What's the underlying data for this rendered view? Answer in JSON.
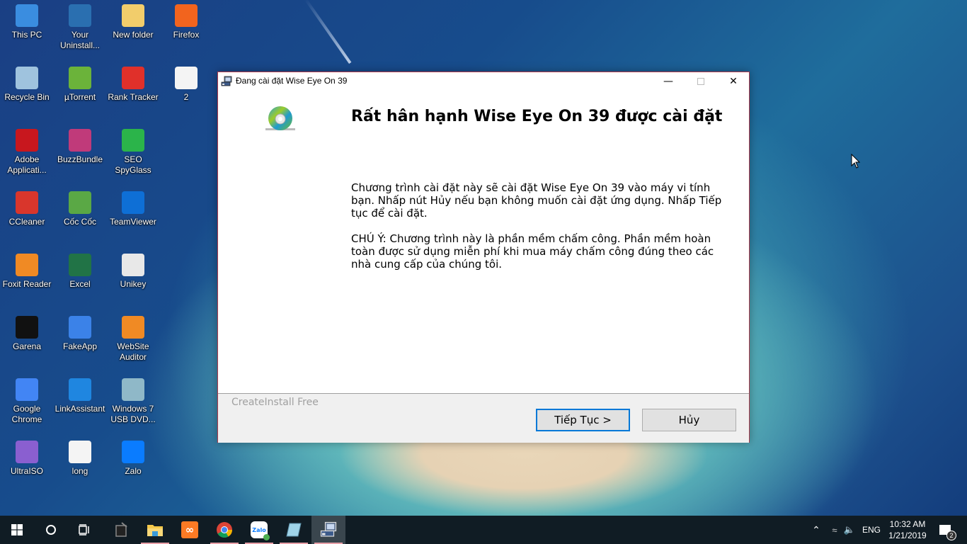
{
  "desktop": {
    "icons": [
      {
        "label": "This PC",
        "icon": "computer-icon",
        "color": "#3a8de0"
      },
      {
        "label": "Your Uninstall...",
        "icon": "uninstaller-icon",
        "color": "#2a6fb0"
      },
      {
        "label": "New folder",
        "icon": "folder-icon",
        "color": "#f2cd6b"
      },
      {
        "label": "Firefox",
        "icon": "firefox-icon",
        "color": "#f2641e"
      },
      {
        "label": "Recycle Bin",
        "icon": "recycle-bin-icon",
        "color": "#9fc3de"
      },
      {
        "label": "µTorrent",
        "icon": "utorrent-icon",
        "color": "#6bb33a"
      },
      {
        "label": "Rank Tracker",
        "icon": "rank-tracker-icon",
        "color": "#e0302a"
      },
      {
        "label": "2",
        "icon": "text-file-icon",
        "color": "#f4f4f4"
      },
      {
        "label": "Adobe Applicati...",
        "icon": "adobe-icon",
        "color": "#c8171e"
      },
      {
        "label": "BuzzBundle",
        "icon": "buzzbundle-icon",
        "color": "#c03a7a"
      },
      {
        "label": "SEO SpyGlass",
        "icon": "seo-spyglass-icon",
        "color": "#2bb44a"
      },
      {
        "label": "CCleaner",
        "icon": "ccleaner-icon",
        "color": "#d9362c"
      },
      {
        "label": "Cốc Cốc",
        "icon": "coccoc-icon",
        "color": "#5aa845"
      },
      {
        "label": "TeamViewer",
        "icon": "teamviewer-icon",
        "color": "#0e6fd6"
      },
      {
        "label": "Foxit Reader",
        "icon": "foxit-reader-icon",
        "color": "#f08a24"
      },
      {
        "label": "Excel",
        "icon": "excel-icon",
        "color": "#217346"
      },
      {
        "label": "Unikey",
        "icon": "unikey-icon",
        "color": "#e8e8e8"
      },
      {
        "label": "Garena",
        "icon": "garena-icon",
        "color": "#111111"
      },
      {
        "label": "FakeApp",
        "icon": "fakeapp-icon",
        "color": "#3b82e8"
      },
      {
        "label": "WebSite Auditor",
        "icon": "website-auditor-icon",
        "color": "#f08a24"
      },
      {
        "label": "Google Chrome",
        "icon": "chrome-icon",
        "color": "#4285f4"
      },
      {
        "label": "LinkAssistant",
        "icon": "linkassistant-icon",
        "color": "#1f86e0"
      },
      {
        "label": "Windows 7 USB DVD...",
        "icon": "windows7-usb-dvd-icon",
        "color": "#8fb8c8"
      },
      {
        "label": "UltraISO",
        "icon": "ultraiso-icon",
        "color": "#8a5fd0"
      },
      {
        "label": "long",
        "icon": "image-file-icon",
        "color": "#f4f4f4"
      },
      {
        "label": "Zalo",
        "icon": "zalo-icon",
        "color": "#0a7cff"
      }
    ]
  },
  "window": {
    "title": "Đang cài đặt Wise Eye On 39",
    "heading": "Rất hân hạnh Wise Eye On 39 được cài đặt",
    "paragraph1": "Chương trình cài đặt này sẽ cài đặt Wise Eye On 39 vào máy vi tính bạn. Nhấp nút Hủy nếu bạn không muốn cài đặt ứng dụng. Nhấp Tiếp tục để cài đặt.",
    "paragraph2": "CHÚ Ý: Chương trình này là phần mềm chấm công. Phần mềm hoàn toàn được sử dụng miễn phí khi mua máy chấm công đúng theo các nhà cung cấp của chúng tôi.",
    "brand": "CreateInstall Free",
    "next_label": "Tiếp Tục >",
    "cancel_label": "Hủy",
    "accent": "#0078d7"
  },
  "taskbar": {
    "pinned": [
      {
        "name": "start",
        "icon": "windows-start-icon"
      },
      {
        "name": "search",
        "icon": "cortana-search-icon"
      },
      {
        "name": "task-view",
        "icon": "task-view-icon"
      },
      {
        "name": "app-4",
        "icon": "notepad-app-icon"
      },
      {
        "name": "file-explorer",
        "icon": "file-explorer-icon"
      },
      {
        "name": "xampp",
        "icon": "xampp-icon"
      },
      {
        "name": "chrome",
        "icon": "chrome-icon"
      },
      {
        "name": "zalo",
        "icon": "zalo-icon"
      },
      {
        "name": "notepad",
        "icon": "notebook-icon"
      },
      {
        "name": "installer",
        "icon": "installer-icon"
      }
    ],
    "tray": {
      "language": "ENG",
      "time": "10:32 AM",
      "date": "1/21/2019",
      "notification_count": "2"
    }
  }
}
